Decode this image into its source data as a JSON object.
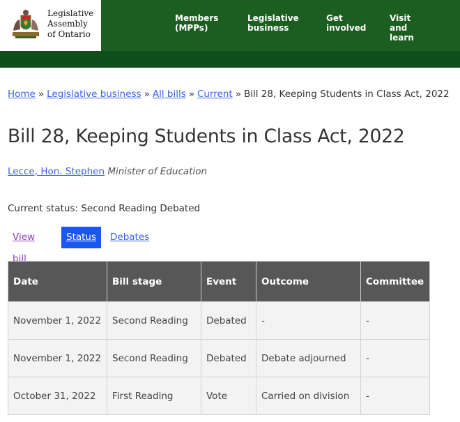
{
  "header": {
    "logo_line1": "Legislative",
    "logo_line2": "Assembly",
    "logo_line3": "of Ontario",
    "nav": [
      {
        "line1": "Members",
        "line2": "(MPPs)"
      },
      {
        "line1": "Legislative",
        "line2": "business"
      },
      {
        "line1": "Get",
        "line2": "involved"
      },
      {
        "line1": "Visit",
        "line2": "and",
        "line3": "learn"
      }
    ]
  },
  "breadcrumb": {
    "home": "Home",
    "legislative_business": "Legislative business",
    "all_bills": "All bills",
    "current": "Current",
    "separator": "»",
    "page": "Bill 28, Keeping Students in Class Act, 2022"
  },
  "page_title": "Bill 28, Keeping Students in Class Act, 2022",
  "sponsor": {
    "name": "Lecce, Hon. Stephen",
    "role": "Minister of Education"
  },
  "current_status": "Current status: Second Reading Debated",
  "tabs": {
    "view_bill": "View bill",
    "status": "Status",
    "debates": "Debates"
  },
  "table": {
    "headers": [
      "Date",
      "Bill stage",
      "Event",
      "Outcome",
      "Committee"
    ],
    "rows": [
      [
        "November 1, 2022",
        "Second Reading",
        "Debated",
        "-",
        "-"
      ],
      [
        "November 1, 2022",
        "Second Reading",
        "Debated",
        "Debate adjourned",
        "-"
      ],
      [
        "October 31, 2022",
        "First Reading",
        "Vote",
        "Carried on division",
        "-"
      ]
    ]
  },
  "colors": {
    "header_green": "#1b5e20",
    "subbar_green": "#0f4d1a",
    "link_blue": "#3b63e0",
    "active_tab": "#1a56f0",
    "table_header": "#575757"
  },
  "icons": {
    "logo": "ontario-coat-of-arms-icon"
  }
}
